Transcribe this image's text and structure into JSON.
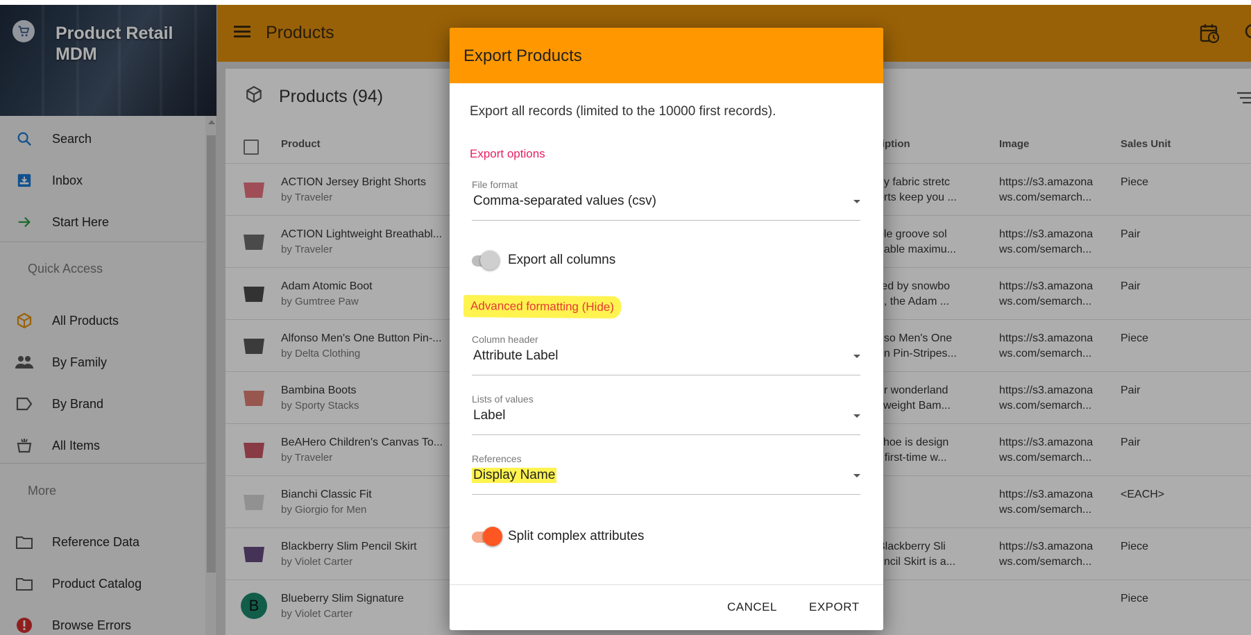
{
  "app": {
    "title": "Product Retail MDM",
    "colors": {
      "appbar": "#e28f0b",
      "dialog_header": "#ff9800",
      "accent": "#e91e63",
      "toggle_on": "#ff5722",
      "highlight": "#fff350"
    }
  },
  "sidebar": {
    "items": [
      {
        "label": "Search",
        "icon": "search-icon"
      },
      {
        "label": "Inbox",
        "icon": "inbox-icon"
      },
      {
        "label": "Start Here",
        "icon": "arrow-right-icon"
      }
    ],
    "quick_access_label": "Quick Access",
    "quick_items": [
      {
        "label": "All Products",
        "icon": "box-icon"
      },
      {
        "label": "By Family",
        "icon": "people-icon"
      },
      {
        "label": "By Brand",
        "icon": "tag-icon"
      },
      {
        "label": "All Items",
        "icon": "basket-icon"
      }
    ],
    "more_label": "More",
    "more_items": [
      {
        "label": "Reference Data",
        "icon": "folder-icon"
      },
      {
        "label": "Product Catalog",
        "icon": "folder-icon"
      },
      {
        "label": "Browse Errors",
        "icon": "error-icon"
      }
    ]
  },
  "header": {
    "title": "Products"
  },
  "main": {
    "title": "Products (94)",
    "columns": {
      "product": "Product",
      "description": "ription",
      "image": "Image",
      "sales_unit": "Sales Unit"
    },
    "rows": [
      {
        "name": "ACTION Jersey Bright Shorts",
        "by": "by Traveler",
        "desc1": "ey fabric stretc",
        "desc2": "orts keep you ...",
        "img1": "https://s3.amazona",
        "img2": "ws.com/semarch...",
        "unit": "Piece",
        "thumb_color": "#e85a6a"
      },
      {
        "name": "ACTION Lightweight Breathabl...",
        "by": "by Traveler",
        "desc1": "ble groove sol",
        "desc2": "nable maximu...",
        "img1": "https://s3.amazona",
        "img2": "ws.com/semarch...",
        "unit": "Pair",
        "thumb_color": "#555555"
      },
      {
        "name": "Adam Atomic Boot",
        "by": "by Gumtree Paw",
        "desc1": "red by snowbo",
        "desc2": "g, the Adam ...",
        "img1": "https://s3.amazona",
        "img2": "ws.com/semarch...",
        "unit": "Pair",
        "thumb_color": "#2a2a2a"
      },
      {
        "name": "Alfonso Men's One Button Pin-...",
        "by": "by Delta Clothing",
        "desc1": "nso Men's One",
        "desc2": "on Pin-Stripes...",
        "img1": "https://s3.amazona",
        "img2": "ws.com/semarch...",
        "unit": "Piece",
        "thumb_color": "#3a3a3a"
      },
      {
        "name": "Bambina Boots",
        "by": "by Sporty Stacks",
        "desc1": "er wonderland",
        "desc2": "yweight Bam...",
        "img1": "https://s3.amazona",
        "img2": "ws.com/semarch...",
        "unit": "Pair",
        "thumb_color": "#d96a5a"
      },
      {
        "name": "BeAHero Children's Canvas To...",
        "by": "by Traveler",
        "desc1": "shoe is design",
        "desc2": "r first-time w...",
        "img1": "https://s3.amazona",
        "img2": "ws.com/semarch...",
        "unit": "Pair",
        "thumb_color": "#c0394a"
      },
      {
        "name": "Bianchi Classic Fit",
        "by": "by Giorgio for Men",
        "desc1": "",
        "desc2": "",
        "img1": "https://s3.amazona",
        "img2": "ws.com/semarch...",
        "unit": "<EACH>",
        "thumb_color": "#cfcfcf"
      },
      {
        "name": "Blackberry Slim Pencil Skirt",
        "by": "by Violet Carter",
        "desc1": "Blackberry Sli",
        "desc2": "encil Skirt is a...",
        "img1": "https://s3.amazona",
        "img2": "ws.com/semarch...",
        "unit": "Piece",
        "thumb_color": "#4a2a6a"
      },
      {
        "name": "Blueberry Slim Signature",
        "by": "by Violet Carter",
        "desc1": "",
        "desc2": "",
        "img1": "",
        "img2": "",
        "unit": "Piece",
        "thumb_color": "#1a8a6e",
        "avatar": "B"
      }
    ]
  },
  "dialog": {
    "title": "Export Products",
    "intro": "Export all records (limited to the 10000 first records).",
    "options_title": "Export options",
    "file_format": {
      "label": "File format",
      "value": "Comma-separated values (csv)"
    },
    "export_all_columns": {
      "label": "Export all columns",
      "on": false
    },
    "advanced_toggle": "Advanced formatting (Hide)",
    "column_header": {
      "label": "Column header",
      "value": "Attribute Label"
    },
    "lists_of_values": {
      "label": "Lists of values",
      "value": "Label"
    },
    "references": {
      "label": "References",
      "value": "Display Name"
    },
    "split_complex": {
      "label": "Split complex attributes",
      "on": true
    },
    "cancel_label": "CANCEL",
    "export_label": "EXPORT"
  }
}
